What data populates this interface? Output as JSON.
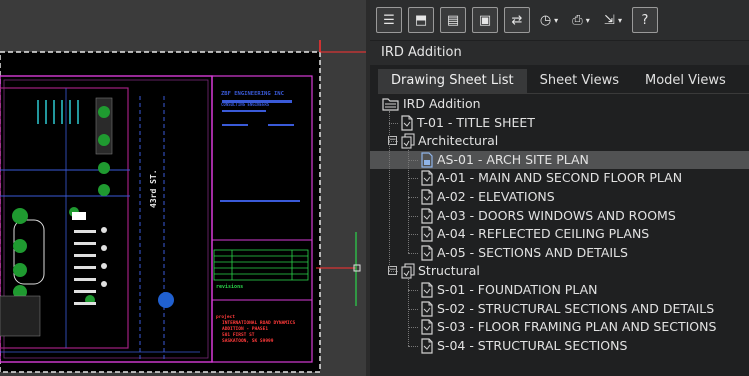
{
  "drawing": {
    "company": "ZBF ENGINEERING INC",
    "company_sub": "CONSULTING ENGINEERS",
    "street_label": "43rd ST.",
    "revisions_label": "revisions",
    "project_label": "project",
    "project_lines": [
      "INTERNATIONAL ROAD DYNAMICS",
      "ADDITION - PHASE1",
      "501 FIRST ST",
      "SASKATOON, SK  S9999"
    ]
  },
  "toolbar": {
    "buttons": [
      {
        "icon": "new-sheet-icon",
        "glyph": "☰",
        "boxed": true
      },
      {
        "icon": "open-folder-icon",
        "glyph": "⬒",
        "boxed": true
      },
      {
        "icon": "sheet-layout-icon",
        "glyph": "▤",
        "boxed": true
      },
      {
        "icon": "preview-sheet-icon",
        "glyph": "▣",
        "boxed": true
      },
      {
        "icon": "refresh-icon",
        "glyph": "⇄",
        "boxed": true
      },
      {
        "icon": "clock-icon",
        "glyph": "◷",
        "boxed": false,
        "dropdown": true
      },
      {
        "icon": "plot-icon",
        "glyph": "⎙",
        "boxed": false,
        "dropdown": true
      },
      {
        "icon": "publish-icon",
        "glyph": "⇲",
        "boxed": false,
        "dropdown": true
      },
      {
        "icon": "help-icon",
        "glyph": "?",
        "boxed": true
      }
    ]
  },
  "sheet_set_name": "IRD Addition",
  "tabs": [
    "Drawing Sheet List",
    "Sheet Views",
    "Model Views"
  ],
  "active_tab": 0,
  "tree": [
    {
      "label": "IRD Addition",
      "type": "root",
      "level": 0
    },
    {
      "label": "T-01 - TITLE SHEET",
      "type": "sheet",
      "level": 1
    },
    {
      "label": "Architectural",
      "type": "group",
      "level": 1,
      "expanded": true
    },
    {
      "label": "AS-01 - ARCH SITE PLAN",
      "type": "sheet",
      "level": 2,
      "selected": true
    },
    {
      "label": "A-01 - MAIN AND SECOND FLOOR PLAN",
      "type": "sheet",
      "level": 2
    },
    {
      "label": "A-02 - ELEVATIONS",
      "type": "sheet",
      "level": 2
    },
    {
      "label": "A-03 - DOORS WINDOWS AND ROOMS",
      "type": "sheet",
      "level": 2
    },
    {
      "label": "A-04 - REFLECTED CEILING PLANS",
      "type": "sheet",
      "level": 2
    },
    {
      "label": "A-05 - SECTIONS AND DETAILS",
      "type": "sheet",
      "level": 2
    },
    {
      "label": "Structural",
      "type": "group",
      "level": 1,
      "expanded": true
    },
    {
      "label": "S-01 - FOUNDATION PLAN",
      "type": "sheet",
      "level": 2
    },
    {
      "label": "S-02 - STRUCTURAL SECTIONS AND DETAILS",
      "type": "sheet",
      "level": 2
    },
    {
      "label": "S-03 - FLOOR FRAMING PLAN AND SECTIONS",
      "type": "sheet",
      "level": 2
    },
    {
      "label": "S-04 - STRUCTURAL SECTIONS",
      "type": "sheet",
      "level": 2
    }
  ]
}
